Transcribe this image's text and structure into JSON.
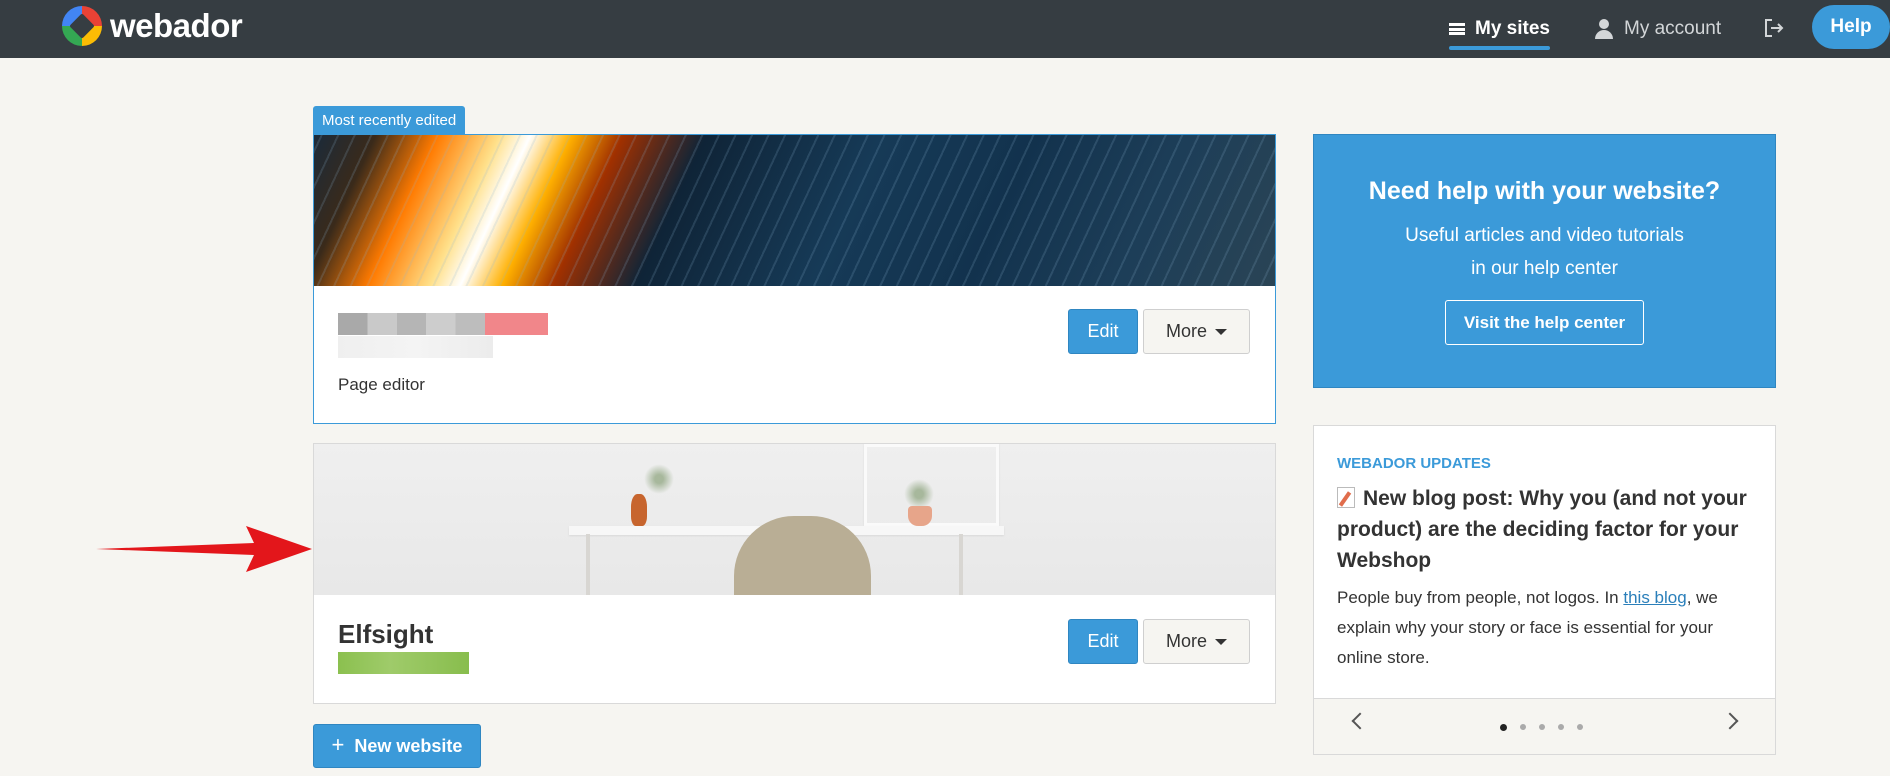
{
  "header": {
    "brand": "webador",
    "nav_my_sites": "My sites",
    "nav_my_account": "My account",
    "help": "Help",
    "colors": {
      "bar": "#363d42",
      "accent": "#3b9ad9"
    }
  },
  "sites": {
    "recent_tag": "Most recently edited",
    "items": [
      {
        "subtitle": "Page editor",
        "edit": "Edit",
        "more": "More"
      },
      {
        "title": "Elfsight",
        "edit": "Edit",
        "more": "More"
      }
    ],
    "new_website": "New website"
  },
  "help_card": {
    "title": "Need help with your website?",
    "line1": "Useful articles and video tutorials",
    "line2": "in our help center",
    "button": "Visit the help center"
  },
  "updates": {
    "label": "WEBADOR UPDATES",
    "title": "New blog post: Why you (and not your product) are the deciding factor for your Webshop",
    "text_before": "People buy from people, not logos. In ",
    "link": "this blog",
    "text_after": ", we explain why your story or face is essential for your online store.",
    "pages": 5,
    "active_page": 1
  },
  "icons": [
    "menu-icon",
    "user-icon",
    "logout-icon",
    "plus-icon",
    "caret-down-icon",
    "document-icon",
    "chevron-left-icon",
    "chevron-right-icon",
    "red-arrow-annotation"
  ]
}
